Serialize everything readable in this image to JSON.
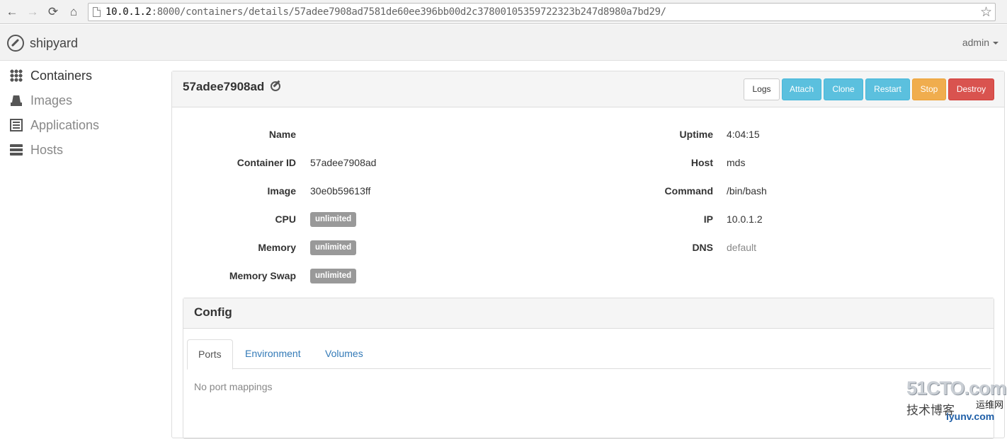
{
  "browser": {
    "url_host": "10.0.1.2",
    "url_rest": ":8000/containers/details/57adee7908ad7581de60ee396bb00d2c37800105359722323b247d8980a7bd29/",
    "back_icon": "arrow-left",
    "forward_icon": "arrow-right",
    "reload_icon": "reload",
    "home_icon": "home",
    "bookmark_icon": "star"
  },
  "navbar": {
    "brand": "shipyard",
    "user": "admin"
  },
  "sidebar": {
    "items": [
      {
        "label": "Containers",
        "icon": "grid-icon",
        "active": true
      },
      {
        "label": "Images",
        "icon": "drive-icon",
        "active": false
      },
      {
        "label": "Applications",
        "icon": "list-icon",
        "active": false
      },
      {
        "label": "Hosts",
        "icon": "server-icon",
        "active": false
      }
    ]
  },
  "container": {
    "title": "57adee7908ad",
    "actions": {
      "logs": "Logs",
      "attach": "Attach",
      "clone": "Clone",
      "restart": "Restart",
      "stop": "Stop",
      "destroy": "Destroy"
    },
    "left": {
      "name_label": "Name",
      "name_value": "",
      "id_label": "Container ID",
      "id_value": "57adee7908ad",
      "image_label": "Image",
      "image_value": "30e0b59613ff",
      "cpu_label": "CPU",
      "cpu_value": "unlimited",
      "memory_label": "Memory",
      "memory_value": "unlimited",
      "swap_label": "Memory Swap",
      "swap_value": "unlimited"
    },
    "right": {
      "uptime_label": "Uptime",
      "uptime_value": "4:04:15",
      "host_label": "Host",
      "host_value": "mds",
      "command_label": "Command",
      "command_value": "/bin/bash",
      "ip_label": "IP",
      "ip_value": "10.0.1.2",
      "dns_label": "DNS",
      "dns_value": "default"
    }
  },
  "config": {
    "title": "Config",
    "tabs": [
      "Ports",
      "Environment",
      "Volumes"
    ],
    "active_tab": "Ports",
    "empty_message": "No port mappings"
  },
  "watermark": {
    "top": "51CTO.com",
    "cn": "技术博客",
    "badge": "运维网",
    "url": "iyunv.com"
  },
  "colors": {
    "info": "#5bc0de",
    "warning": "#f0ad4e",
    "danger": "#d9534f",
    "link": "#337ab7",
    "badge": "#999999"
  }
}
